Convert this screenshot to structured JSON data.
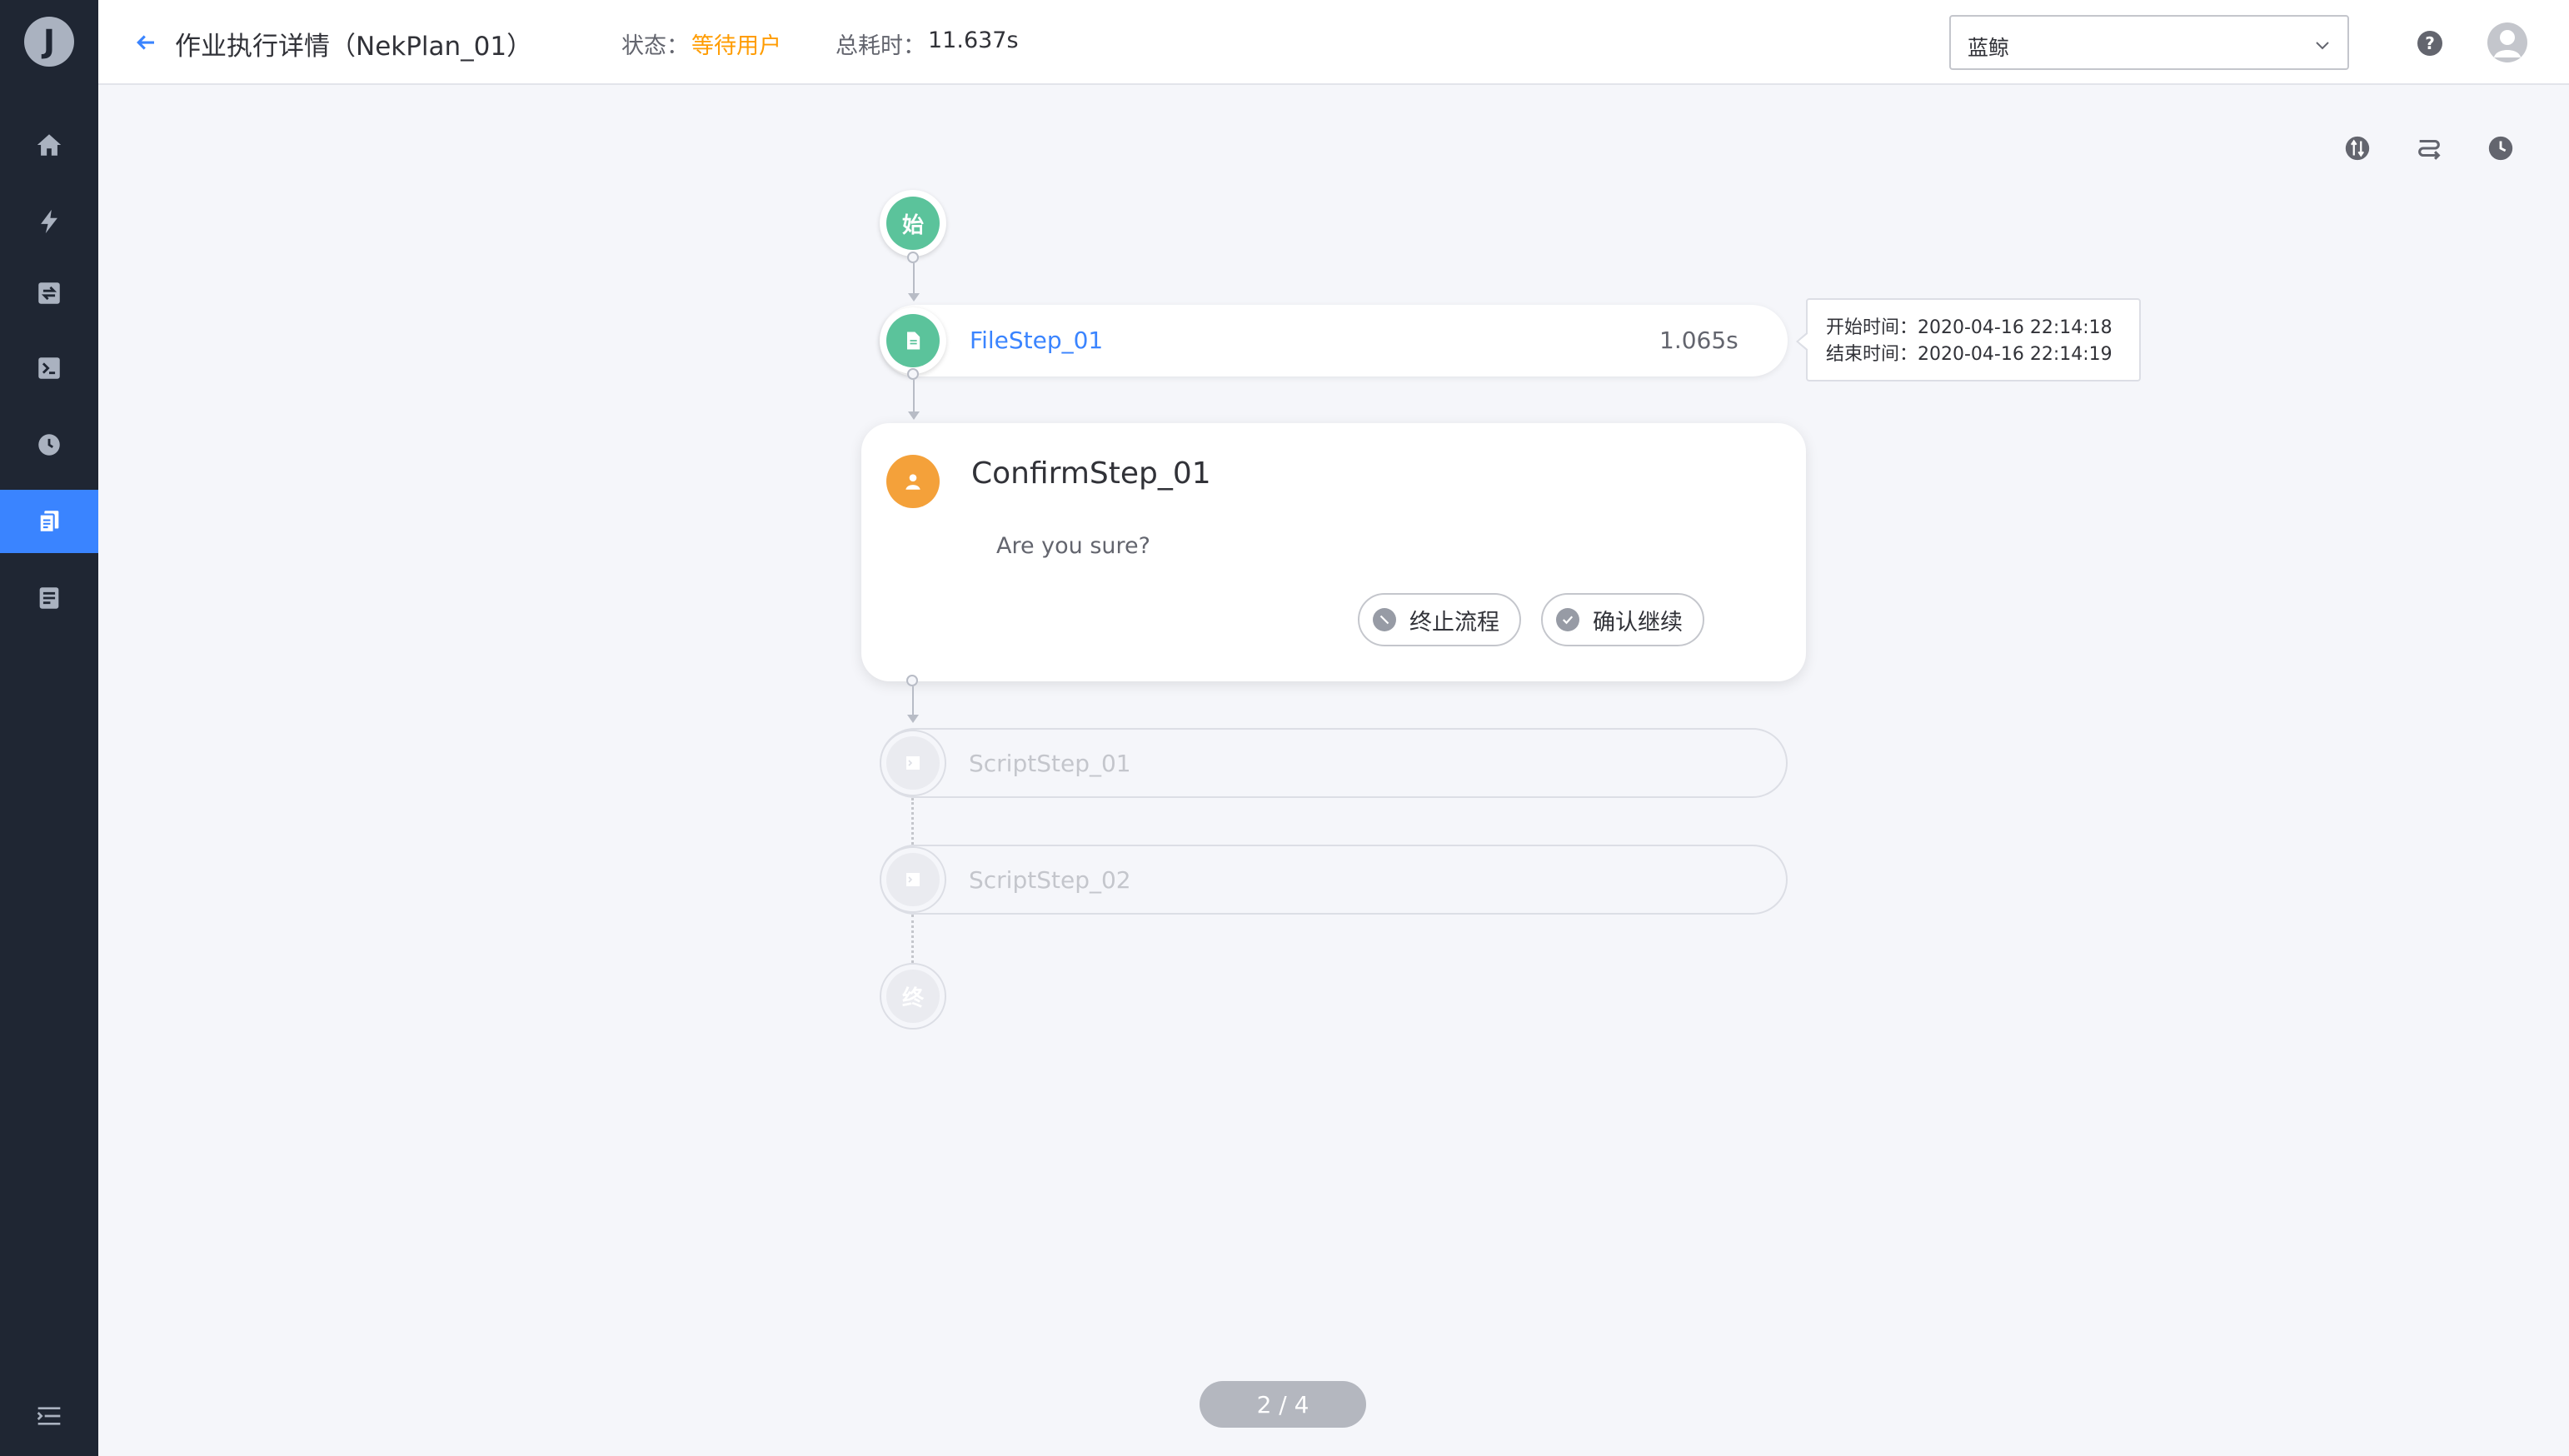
{
  "sidebar": {
    "logo_letter": "J",
    "items": [
      {
        "icon": "home-icon",
        "active": false
      },
      {
        "icon": "lightning-icon",
        "active": false
      },
      {
        "icon": "transfer-icon",
        "active": false
      },
      {
        "icon": "terminal-icon",
        "active": false
      },
      {
        "icon": "clock-icon",
        "active": false
      },
      {
        "icon": "copy-icon",
        "active": true
      },
      {
        "icon": "task-list-icon",
        "active": false
      }
    ],
    "collapse_icon": "menu-collapse-icon",
    "colors": {
      "background": "#1f2633",
      "active": "#3a84ff",
      "icon": "#aab2c0"
    }
  },
  "header": {
    "title": "作业执行详情（NekPlan_01）",
    "status_label": "状态：",
    "status_value": "等待用户",
    "time_label": "总耗时：",
    "time_value": "11.637s",
    "business_select": "蓝鲸",
    "help": "?",
    "colors": {
      "status": "#ff9c01"
    }
  },
  "toolbar": {
    "icons": [
      "compare-icon",
      "route-icon",
      "history-icon"
    ]
  },
  "flow": {
    "start_label": "始",
    "end_label": "终",
    "steps": [
      {
        "name": "FileStep_01",
        "time": "1.065s",
        "state": "done",
        "icon": "file-icon"
      },
      {
        "name": "ConfirmStep_01",
        "state": "waiting",
        "icon": "user-icon"
      },
      {
        "name": "ScriptStep_01",
        "state": "pending",
        "icon": "script-icon"
      },
      {
        "name": "ScriptStep_02",
        "state": "pending",
        "icon": "script-icon"
      }
    ],
    "tooltip": {
      "start": "开始时间：2020-04-16 22:14:18",
      "end": "结束时间：2020-04-16 22:14:19"
    },
    "confirm": {
      "message": "Are you sure?",
      "terminate_label": "终止流程",
      "continue_label": "确认继续"
    },
    "colors": {
      "done": "#5bc39b",
      "waiting": "#f4a13a",
      "pending": "#dcdee5",
      "link": "#3a84ff"
    }
  },
  "pager": {
    "text": "2 / 4"
  }
}
